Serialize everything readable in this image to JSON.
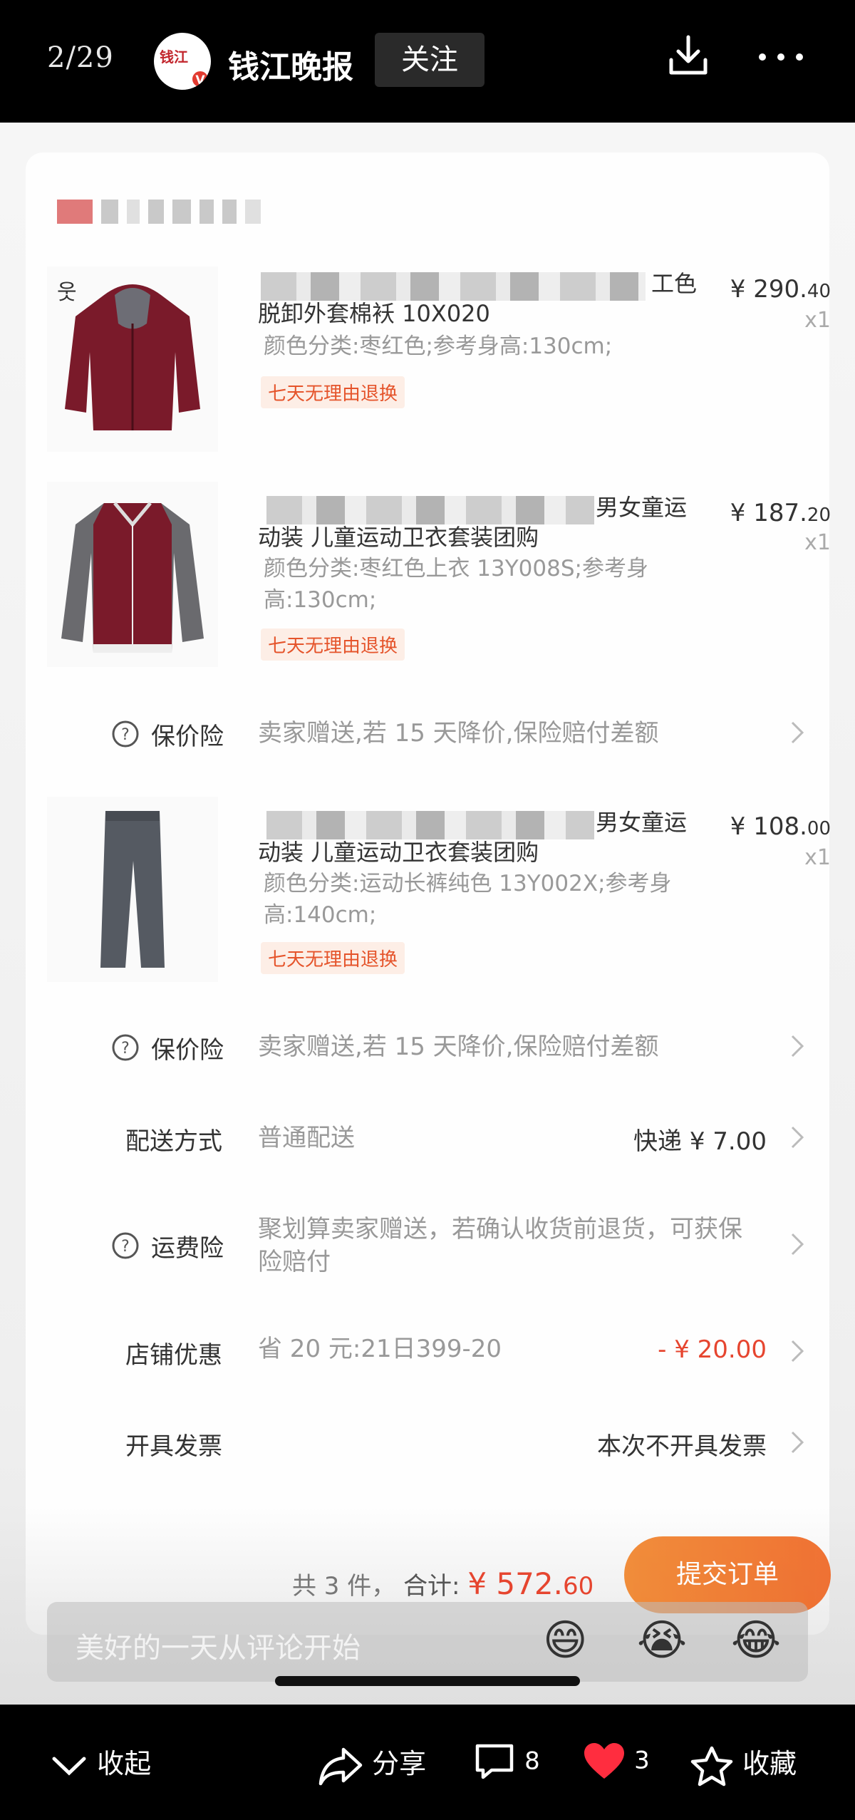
{
  "header": {
    "page_counter": "2/29",
    "account_name": "钱江晚报",
    "follow_label": "关注"
  },
  "items": [
    {
      "title_line1_end": "工色",
      "title_line2": "脱卸外套棉袄 10X020",
      "spec": "颜色分类:枣红色;参考身高:130cm;",
      "tag": "七天无理由退换",
      "price": "¥ 290.",
      "price_cents": "40",
      "qty": "x1"
    },
    {
      "title_line1_end": "男女童运",
      "title_line2": "动装 儿童运动卫衣套装团购",
      "spec": "颜色分类:枣红色上衣 13Y008S;参考身高:130cm;",
      "tag": "七天无理由退换",
      "price": "¥ 187.",
      "price_cents": "20",
      "qty": "x1"
    },
    {
      "title_line1_end": "男女童运",
      "title_line2": "动装 儿童运动卫衣套装团购",
      "spec": "颜色分类:运动长裤纯色 13Y002X;参考身高:140cm;",
      "tag": "七天无理由退换",
      "price": "¥ 108.",
      "price_cents": "00",
      "qty": "x1"
    }
  ],
  "insurance": {
    "label": "保价险",
    "text": "卖家赠送,若 15 天降价,保险赔付差额"
  },
  "delivery": {
    "label": "配送方式",
    "text": "普通配送",
    "value": "快递 ¥ 7.00"
  },
  "freight_insurance": {
    "label": "运费险",
    "text": "聚划算卖家赠送，若确认收货前退货，可获保险赔付"
  },
  "shop_discount": {
    "label": "店铺优惠",
    "text": "省 20 元:21日399-20",
    "value": "- ¥ 20.00"
  },
  "invoice": {
    "label": "开具发票",
    "value": "本次不开具发票"
  },
  "footer": {
    "count_text": "共 3 件，",
    "total_label": "合计:",
    "total_amount": "¥ 572.",
    "total_cents": "60",
    "submit_label": "提交订单"
  },
  "comment": {
    "placeholder": "美好的一天从评论开始",
    "emojis": [
      "😄",
      "😭",
      "😂"
    ]
  },
  "actions": {
    "collapse": "收起",
    "share": "分享",
    "comments_count": "8",
    "likes_count": "3",
    "favorite": "收藏"
  },
  "colors": {
    "accent_red": "#e6452f",
    "submit_orange": "#ee5a12",
    "heart_red": "#ff2d3f"
  }
}
